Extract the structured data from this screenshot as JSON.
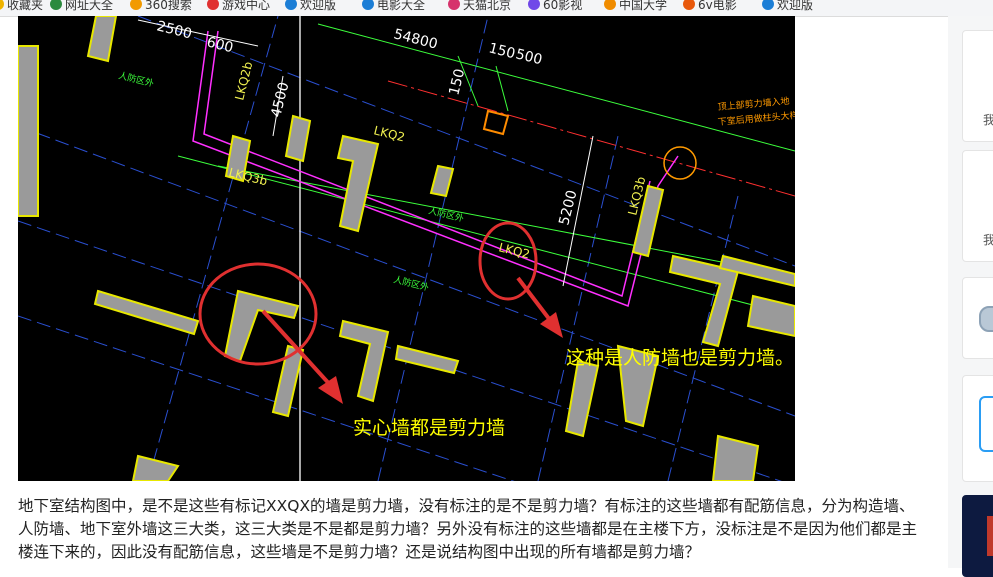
{
  "bookmarks": [
    {
      "label": "收藏夹",
      "icon": "folder-icon",
      "color": "#f0b400"
    },
    {
      "label": "网址大全",
      "icon": "globe-icon",
      "color": "#2b8a3e"
    },
    {
      "label": "360搜索",
      "icon": "search-icon",
      "color": "#f29a00"
    },
    {
      "label": "游戏中心",
      "icon": "game-icon",
      "color": "#e03131"
    },
    {
      "label": "欢迎版",
      "icon": "flag-icon",
      "color": "#1c7ed6"
    },
    {
      "label": "电影大全",
      "icon": "film-icon",
      "color": "#1c7ed6"
    },
    {
      "label": "天猫北京",
      "icon": "tmall-icon",
      "color": "#d6336c"
    },
    {
      "label": "60影视",
      "icon": "video-icon",
      "color": "#7048e8"
    },
    {
      "label": "中国大学",
      "icon": "star-icon",
      "color": "#f08c00"
    },
    {
      "label": "6v电影",
      "icon": "film-icon",
      "color": "#e8590c"
    },
    {
      "label": "欢迎版",
      "icon": "flag-icon",
      "color": "#1c7ed6"
    }
  ],
  "drawing": {
    "dims": [
      "2500",
      "600",
      "54800",
      "150",
      "500",
      "150",
      "4500",
      "5200"
    ],
    "wall_labels": [
      "LKQ2",
      "LKQ3b",
      "LKQ2b",
      "LKQ2",
      "LKQ3b"
    ],
    "room_labels": [
      "人防区外",
      "人防区外",
      "人防区外"
    ],
    "note_line1": "顶上部剪力墙入地",
    "note_line2": "下室后用做柱头大样",
    "annotation_solid_walls": "实心墙都是剪力墙",
    "annotation_civil_defense": "这种是人防墙也是剪力墙。",
    "colors": {
      "wall": "#9a9a9a",
      "wall_edge": "#e8e800",
      "magenta": "#ff30ff",
      "green": "#3cff3c",
      "red": "#ff3030",
      "annotation": "#ffff00"
    }
  },
  "question": {
    "text": "地下室结构图中，是不是这些有标记XXQX的墙是剪力墙，没有标注的是不是剪力墙？有标注的这些墙都有配筋信息，分为构造墙、人防墙、地下室外墙这三大类，这三大类是不是都是剪力墙？另外没有标注的这些墙都是在主楼下方，没标注是不是因为他们都是主楼连下来的，因此没有配筋信息，这些墙是不是剪力墙？还是说结构图中出现的所有墙都是剪力墙？"
  },
  "sidebar": {
    "cards": [
      {
        "label": "我",
        "icon": "user-icon"
      },
      {
        "label": "我",
        "icon": "user-icon"
      },
      {
        "label": "",
        "icon": "medal-icon"
      },
      {
        "label": "",
        "icon": "phone-icon"
      },
      {
        "label": "",
        "icon": "thumbnail-icon"
      }
    ]
  }
}
